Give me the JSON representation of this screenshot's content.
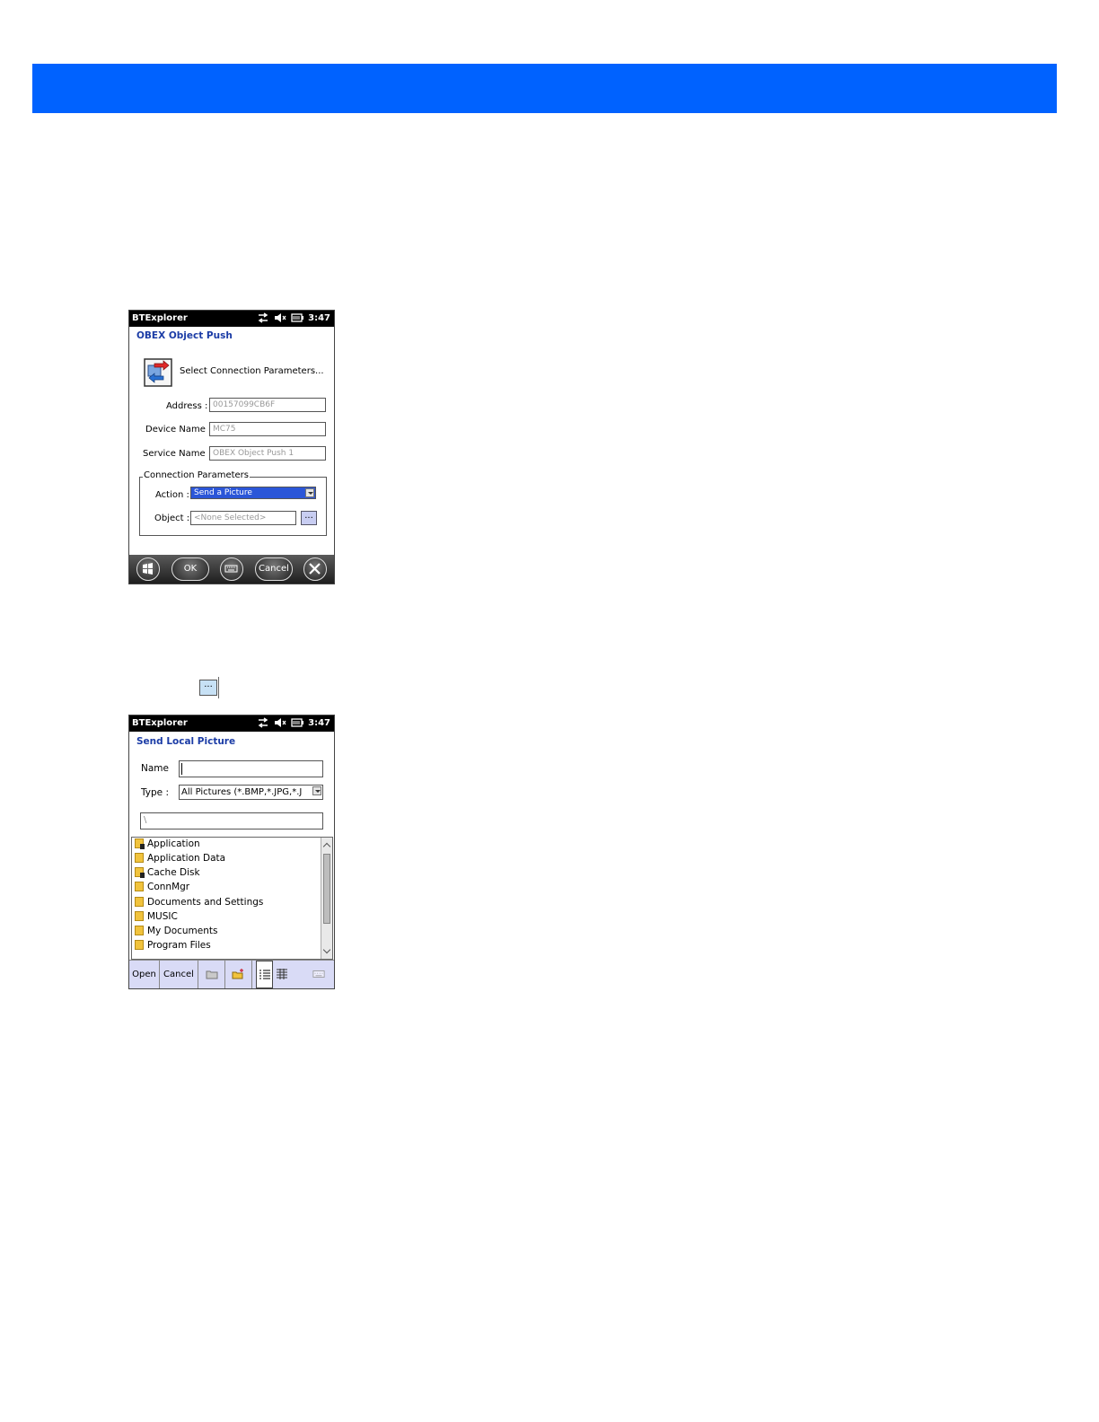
{
  "banner": {
    "color": "#0062ff"
  },
  "screen1": {
    "status": {
      "app": "BTExplorer",
      "time": "3:47"
    },
    "title": "OBEX Object Push",
    "prompt": "Select Connection Parameters...",
    "fields": {
      "address": {
        "label": "Address :",
        "value": "00157099CB6F"
      },
      "device_name": {
        "label": "Device Name :",
        "value": "MC75"
      },
      "service_name": {
        "label": "Service Name :",
        "value": "OBEX Object Push 1"
      }
    },
    "group_label": "Connection Parameters",
    "action": {
      "label": "Action :",
      "value": "Send a Picture"
    },
    "object": {
      "label": "Object :",
      "value": "<None Selected>",
      "browse_label": "..."
    },
    "buttons": {
      "ok": "OK",
      "cancel": "Cancel"
    }
  },
  "inline_button": {
    "label": "..."
  },
  "screen2": {
    "status": {
      "app": "BTExplorer",
      "time": "3:47"
    },
    "title": "Send Local Picture",
    "name_label": "Name",
    "name_value": "",
    "type_label": "Type :",
    "type_value": "All Pictures (*.BMP,*.JPG,*.J",
    "path_value": "\\",
    "folders": [
      {
        "name": "Application",
        "dark": true
      },
      {
        "name": "Application Data",
        "dark": false
      },
      {
        "name": "Cache Disk",
        "dark": true
      },
      {
        "name": "ConnMgr",
        "dark": false
      },
      {
        "name": "Documents and Settings",
        "dark": false
      },
      {
        "name": "MUSIC",
        "dark": false
      },
      {
        "name": "My Documents",
        "dark": false
      },
      {
        "name": "Program Files",
        "dark": false
      }
    ],
    "menu": {
      "open": "Open",
      "cancel": "Cancel"
    }
  }
}
